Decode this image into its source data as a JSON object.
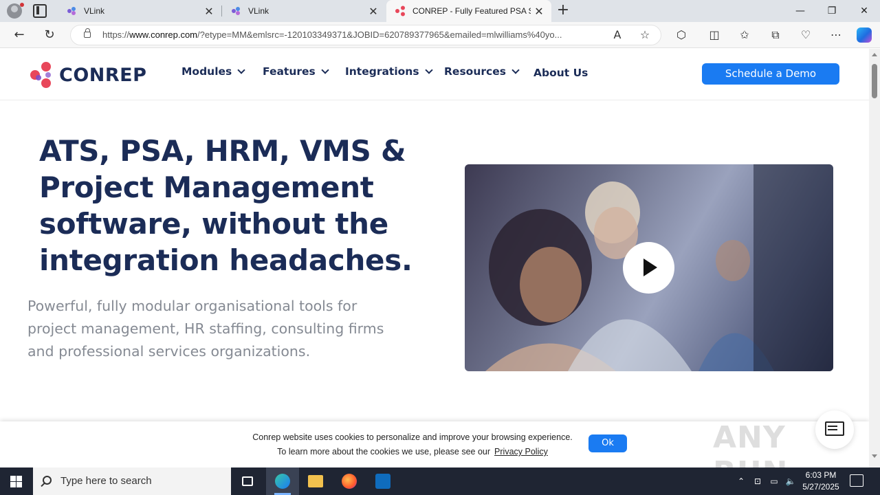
{
  "browser": {
    "tabs": [
      {
        "title": "VLink",
        "active": false
      },
      {
        "title": "VLink",
        "active": false
      },
      {
        "title": "CONREP - Fully Featured PSA So",
        "active": true
      }
    ],
    "url_prefix": "https://",
    "url_domain": "www.conrep.com",
    "url_rest": "/?etype=MM&emlsrc=-120103349371&JOBID=620789377965&emailed=mlwilliams%40yo..."
  },
  "site": {
    "logo_text": "CONREP",
    "nav": [
      {
        "label": "Modules"
      },
      {
        "label": "Features"
      },
      {
        "label": "Integrations"
      },
      {
        "label": "Resources"
      },
      {
        "label": "About Us"
      }
    ],
    "demo_button": "Schedule a Demo",
    "hero": {
      "headline_lines": [
        "ATS, PSA, HRM, VMS &",
        "Project Management",
        "software, without the",
        "integration headaches."
      ],
      "subtext_lines": [
        "Powerful, fully modular organisational tools for",
        "project management, HR staffing, consulting firms",
        "and professional services organizations."
      ]
    },
    "cookie": {
      "line1": "Conrep website uses cookies to personalize and improve your browsing experience.",
      "line2": "To learn more about the cookies we use, please see our",
      "link": "Privacy Policy",
      "ok": "Ok"
    },
    "watermark": "ANY RUN"
  },
  "taskbar": {
    "search_placeholder": "Type here to search",
    "time": "6:03 PM",
    "date": "5/27/2025"
  },
  "colors": {
    "brand_navy": "#1b2c57",
    "accent_blue": "#1a7bf2",
    "logo_red": "#e8475a"
  }
}
